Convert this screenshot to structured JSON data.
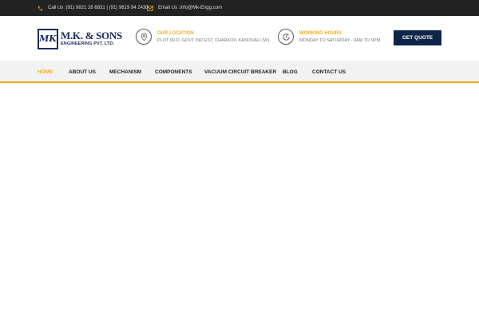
{
  "topbar": {
    "phone_text": "Call Us :(91) 9821 28 6831 | (91) 9619 94 2430",
    "email_text": "Email Us :info@Mk-Engg.com",
    "phone_icon": "phone-icon",
    "email_icon": "envelope-icon"
  },
  "logo": {
    "mark": "MK",
    "name": "M.K. & SONS",
    "subtitle": "ENGINEERING PVT. LTD."
  },
  "location": {
    "title": "OUR LOCATION",
    "value": "PLOT 69-D, GOVT IND EST, CHARKOP, KANDIVALI (W)",
    "icon": "map-pin-icon"
  },
  "hours": {
    "title": "WORKING HOURS",
    "value": "MONDAY TO SATURDAY - 9AM TO 9PM",
    "icon": "clock-icon"
  },
  "quote_button": "GET QUOTE",
  "nav": {
    "items": [
      {
        "label": "HOME",
        "active": true
      },
      {
        "label": "ABOUT US",
        "active": false
      },
      {
        "label": "MECHANISM",
        "active": false
      },
      {
        "label": "COMPONENTS",
        "active": false
      },
      {
        "label": "VACUUM CIRCUIT BREAKER",
        "active": false
      },
      {
        "label": "BLOG",
        "active": false
      },
      {
        "label": "CONTACT US",
        "active": false
      }
    ]
  },
  "colors": {
    "accent": "#f0b020",
    "topbar_bg": "#222222",
    "brand_navy": "#0d2548",
    "nav_bg": "#f2f2f2"
  }
}
